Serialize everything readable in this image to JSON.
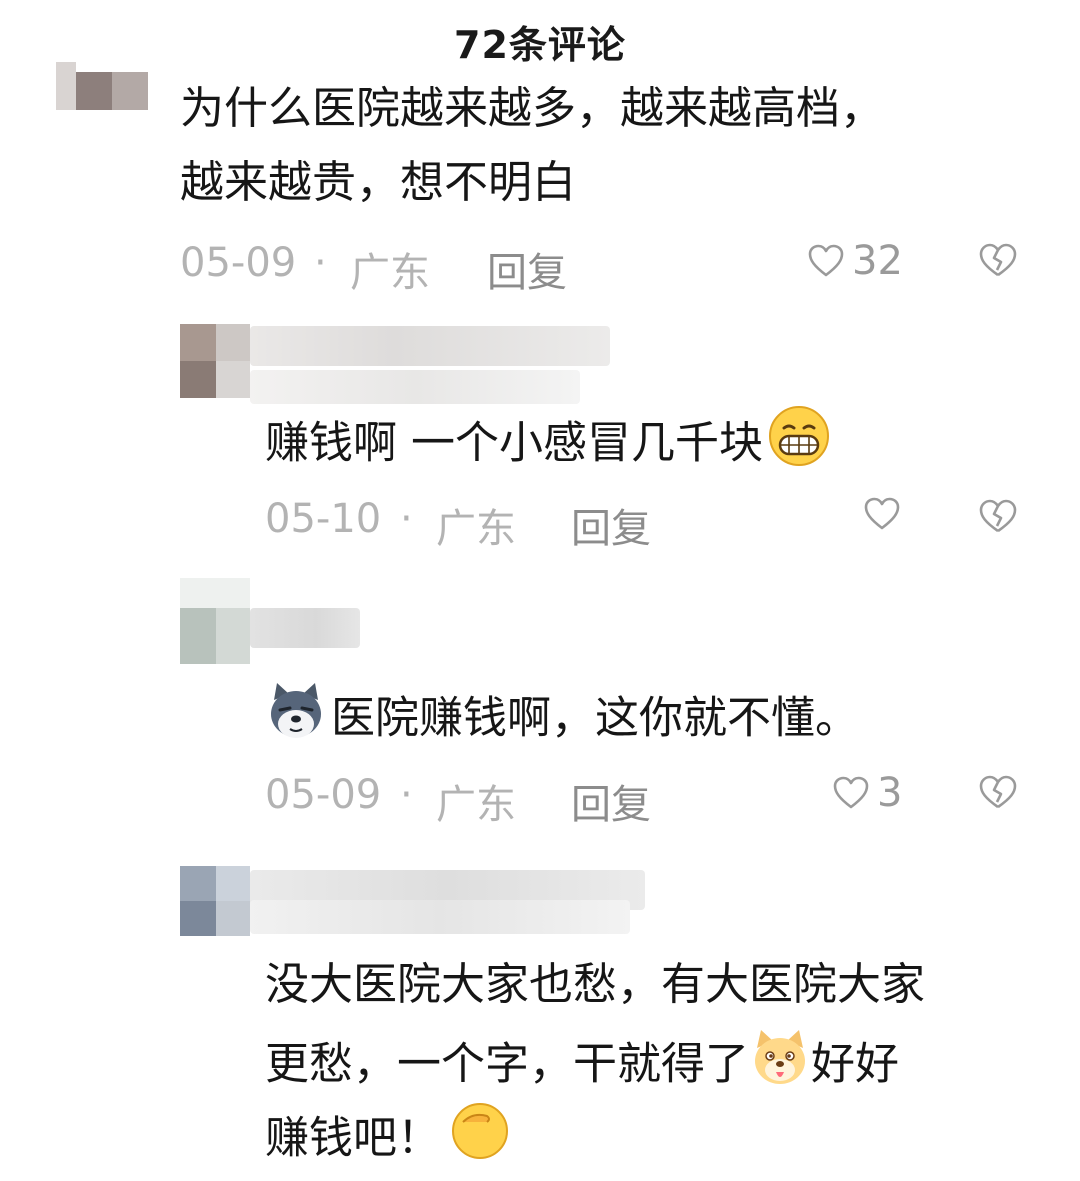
{
  "header": {
    "title": "72条评论"
  },
  "comments": [
    {
      "text_lines": [
        "为什么医院越来越多，越来越高档，",
        "越来越贵，想不明白"
      ],
      "date": "05-09",
      "sep": "·",
      "region": "广东",
      "reply_label": "回复",
      "likes": "32"
    },
    {
      "text_lines": [
        "赚钱啊 一个小感冒几千块"
      ],
      "emoji": "grin-emoji",
      "date": "05-10",
      "sep": "·",
      "region": "广东",
      "reply_label": "回复",
      "likes": ""
    },
    {
      "text_lines": [
        "医院赚钱啊，这你就不懂。"
      ],
      "emoji": "wolf-emoji",
      "date": "05-09",
      "sep": "·",
      "region": "广东",
      "reply_label": "回复",
      "likes": "3"
    },
    {
      "text_lines": [
        "没大医院大家也愁，有大医院大家",
        "更愁，一个字，干就得了",
        "好好",
        "赚钱吧！"
      ],
      "emoji": "doge-emoji"
    }
  ],
  "icons": {
    "like": "heart-outline-icon",
    "dislike": "broken-heart-icon"
  },
  "colors": {
    "text": "#161616",
    "meta": "#b3b3b3",
    "reply": "#8c8c8c"
  }
}
